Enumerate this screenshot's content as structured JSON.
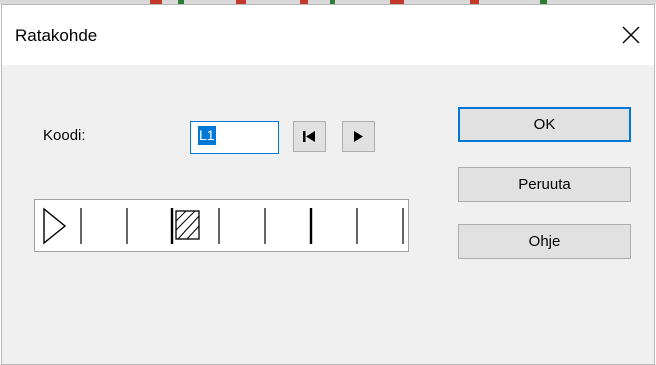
{
  "dialog": {
    "title": "Ratakohde",
    "close_icon": "close-icon"
  },
  "form": {
    "code_label": "Koodi:",
    "code_value": "L1",
    "first_icon": "skip-to-first-icon",
    "next_icon": "play-next-icon"
  },
  "track": {
    "icons": [
      "start-triangle-icon",
      "hatched-box-icon"
    ]
  },
  "buttons": {
    "ok": "OK",
    "cancel": "Peruuta",
    "help": "Ohje"
  },
  "colors": {
    "accent": "#0078d7",
    "dialog_bg": "#f0f0f0",
    "button_bg": "#e1e1e1"
  }
}
